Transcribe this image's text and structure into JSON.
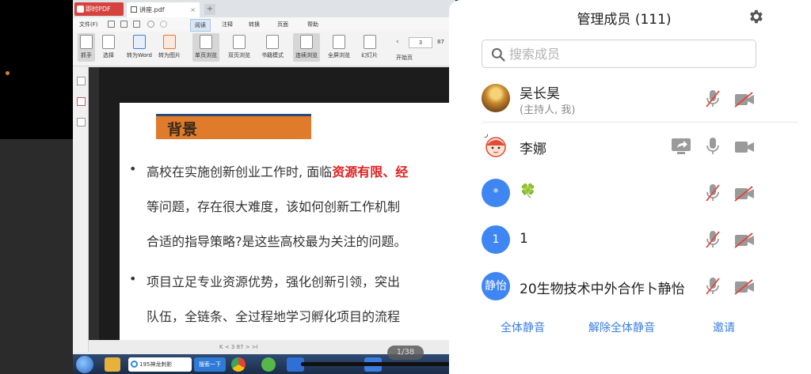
{
  "pdf_app": {
    "app_tab": "即时PDF",
    "doc_tab": "讲座.pdf",
    "new_tab": "+",
    "menu": {
      "file": "文件(F)",
      "browse": "阅读",
      "note": "注释",
      "convert": "转换",
      "page": "页面",
      "help": "帮助"
    },
    "toolbar": [
      {
        "label": "抓手",
        "icon": "hand-icon",
        "selected": true
      },
      {
        "label": "选择",
        "icon": "cursor-icon"
      },
      {
        "label": "转为Word",
        "icon": "word-icon"
      },
      {
        "label": "转为图片",
        "icon": "image-icon"
      },
      {
        "label": "单页浏览",
        "icon": "single-page-icon",
        "selected": true
      },
      {
        "label": "双页浏览",
        "icon": "double-page-icon"
      },
      {
        "label": "书籍模式",
        "icon": "book-icon"
      },
      {
        "label": "连续浏览",
        "icon": "continuous-icon",
        "selected": true
      },
      {
        "label": "全屏浏览",
        "icon": "fullscreen-icon"
      },
      {
        "label": "幻灯片",
        "icon": "slideshow-icon"
      }
    ],
    "page_input": "3",
    "page_total": "87",
    "first_page": "开始页",
    "status_nav": "K <  3  87  > >I"
  },
  "slide": {
    "heading": "背景",
    "bullet": "•",
    "p1_l1_a": "高校在实施创新创业工作时, 面临",
    "p1_l1_b": "资源有限、经",
    "p1_l2": "等问题，存在很大难度，该如何创新工作机制",
    "p1_l3": "合适的指导策略?是这些高校最为关注的问题。",
    "p2_l1": "项目立足专业资源优势，强化创新引领，突出",
    "p2_l2": "队伍，全链条、全过程地学习孵化项目的流程"
  },
  "page_indicator": "1/38",
  "taskbar": {
    "ie_label": "195神龙刺影",
    "search_label": "搜索一下"
  },
  "panel": {
    "title": "管理成员 (111)",
    "search_placeholder": "搜索成员",
    "members": [
      {
        "name": "吴长昊",
        "sub": "(主持人, 我)",
        "avatar": "",
        "mic_muted": true,
        "cam_off": true,
        "sharing": false
      },
      {
        "name": "李娜",
        "sub": "",
        "avatar": "",
        "mic_muted": false,
        "cam_off": false,
        "sharing": true
      },
      {
        "name": "🍀",
        "sub": "",
        "avatar": "*",
        "mic_muted": true,
        "cam_off": true,
        "sharing": false
      },
      {
        "name": "1",
        "sub": "",
        "avatar": "1",
        "mic_muted": true,
        "cam_off": true,
        "sharing": false
      },
      {
        "name": "20生物技术中外合作卜静怡",
        "sub": "",
        "avatar": "静怡",
        "mic_muted": true,
        "cam_off": true,
        "sharing": false
      }
    ],
    "footer": {
      "mute_all": "全体静音",
      "unmute_all": "解除全体静音",
      "invite": "邀请"
    }
  },
  "colors": {
    "accent": "#3a7ee0",
    "mute_red": "#e0453a",
    "slide_orange": "#e07b2b"
  }
}
